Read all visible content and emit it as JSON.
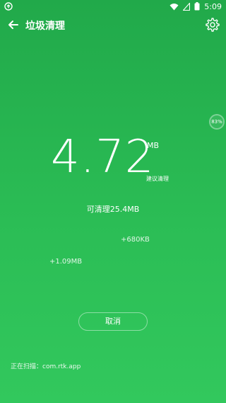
{
  "status": {
    "time": "5:09"
  },
  "header": {
    "title": "垃圾清理"
  },
  "badge": {
    "percent": "83%"
  },
  "junk": {
    "size_value": "4.72",
    "size_unit": "MB",
    "suggest_label": "建议清理",
    "cleanable_text": "可清理25.4MB",
    "float_items": [
      "+680KB",
      "+1.09MB"
    ]
  },
  "actions": {
    "cancel_label": "取消"
  },
  "scan": {
    "status_text": "正在扫描：com.rtk.app"
  },
  "colors": {
    "background_top": "#21a94a",
    "background_bottom": "#32c85d",
    "text": "#ffffff"
  }
}
